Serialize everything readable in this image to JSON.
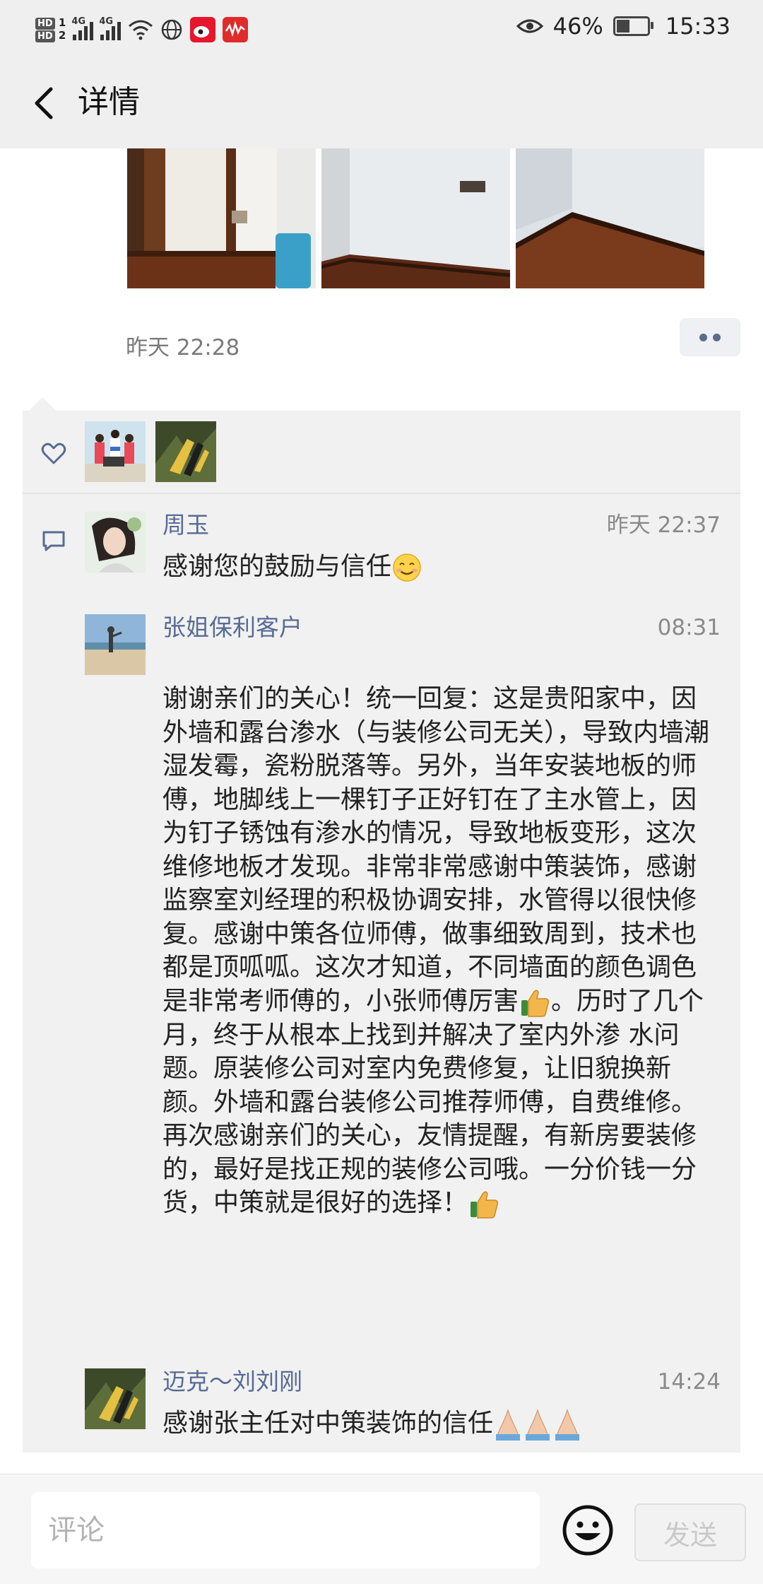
{
  "status_bar": {
    "battery_percent": "46%",
    "time": "15:33",
    "network_1": "4G",
    "network_2": "4G",
    "sim_1": "HD",
    "sim_2": "HD"
  },
  "header": {
    "title": "详情"
  },
  "post": {
    "time": "昨天 22:28"
  },
  "comments": [
    {
      "author": "周玉",
      "time": "昨天 22:37",
      "text": "感谢您的鼓励与信任"
    },
    {
      "author": "张姐保利客户",
      "time": "08:31",
      "text_part1": "谢谢亲们的关心！统一回复：这是贵阳家中，因外墙和露台渗水（与装修公司无关），导致内墙潮湿发霉，瓷粉脱落等。另外，当年安装地板的师傅，地脚线上一棵钉子正好钉在了主水管上，因为钉子锈蚀有渗水的情况，导致地板变形，这次维修地板才发现。非常非常感谢中策装饰，感谢监察室刘经理的积极协调安排，水管得以很快修复。感谢中策各位师傅，做事细致周到，技术也都是顶呱呱。这次才知道，不同墙面的颜色调色是非常考师傅的，小张师傅厉害",
      "text_part2": "。历时了几个月，终于从根本上找到并解决了室内外渗 水问题。原装修公司对室内免费修复，让旧貌换新颜。外墙和露台装修公司推荐师傅，自费维修。再次感谢亲们的关心，友情提醒，有新房要装修的，最好是找正规的装修公司哦。一分价钱一分货，中策就是很好的选择！"
    },
    {
      "author": "迈克～刘刘刚",
      "time": "14:24",
      "text": "感谢张主任对中策装饰的信任"
    }
  ],
  "input": {
    "placeholder": "评论",
    "value": ""
  },
  "send_label": "发送",
  "colors": {
    "link_blue": "#576b95",
    "panel_bg": "#f1f1f1",
    "header_bg": "#efefef"
  }
}
